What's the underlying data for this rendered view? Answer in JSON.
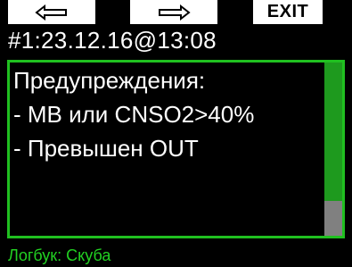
{
  "softkeys": {
    "left_icon": "left-arrow-icon",
    "right_icon": "right-arrow-icon",
    "exit_label": "EXIT"
  },
  "header": {
    "title": "#1:23.12.16@13:08"
  },
  "warnings": {
    "lines": [
      "Предупреждения:",
      "- МВ или CNSO2>40%",
      "- Превышен OUT"
    ]
  },
  "scrollbar": {
    "position_fraction": 0.0,
    "visible_fraction": 0.8
  },
  "footer": {
    "label": "Логбук: Скуба"
  },
  "colors": {
    "background": "#000000",
    "softkey_bg": "#ffffff",
    "accent_green": "#20c020",
    "footer_green": "#22d022",
    "scroll_thumb": "#1e9a1e",
    "scroll_track": "#808080",
    "text": "#ffffff"
  }
}
